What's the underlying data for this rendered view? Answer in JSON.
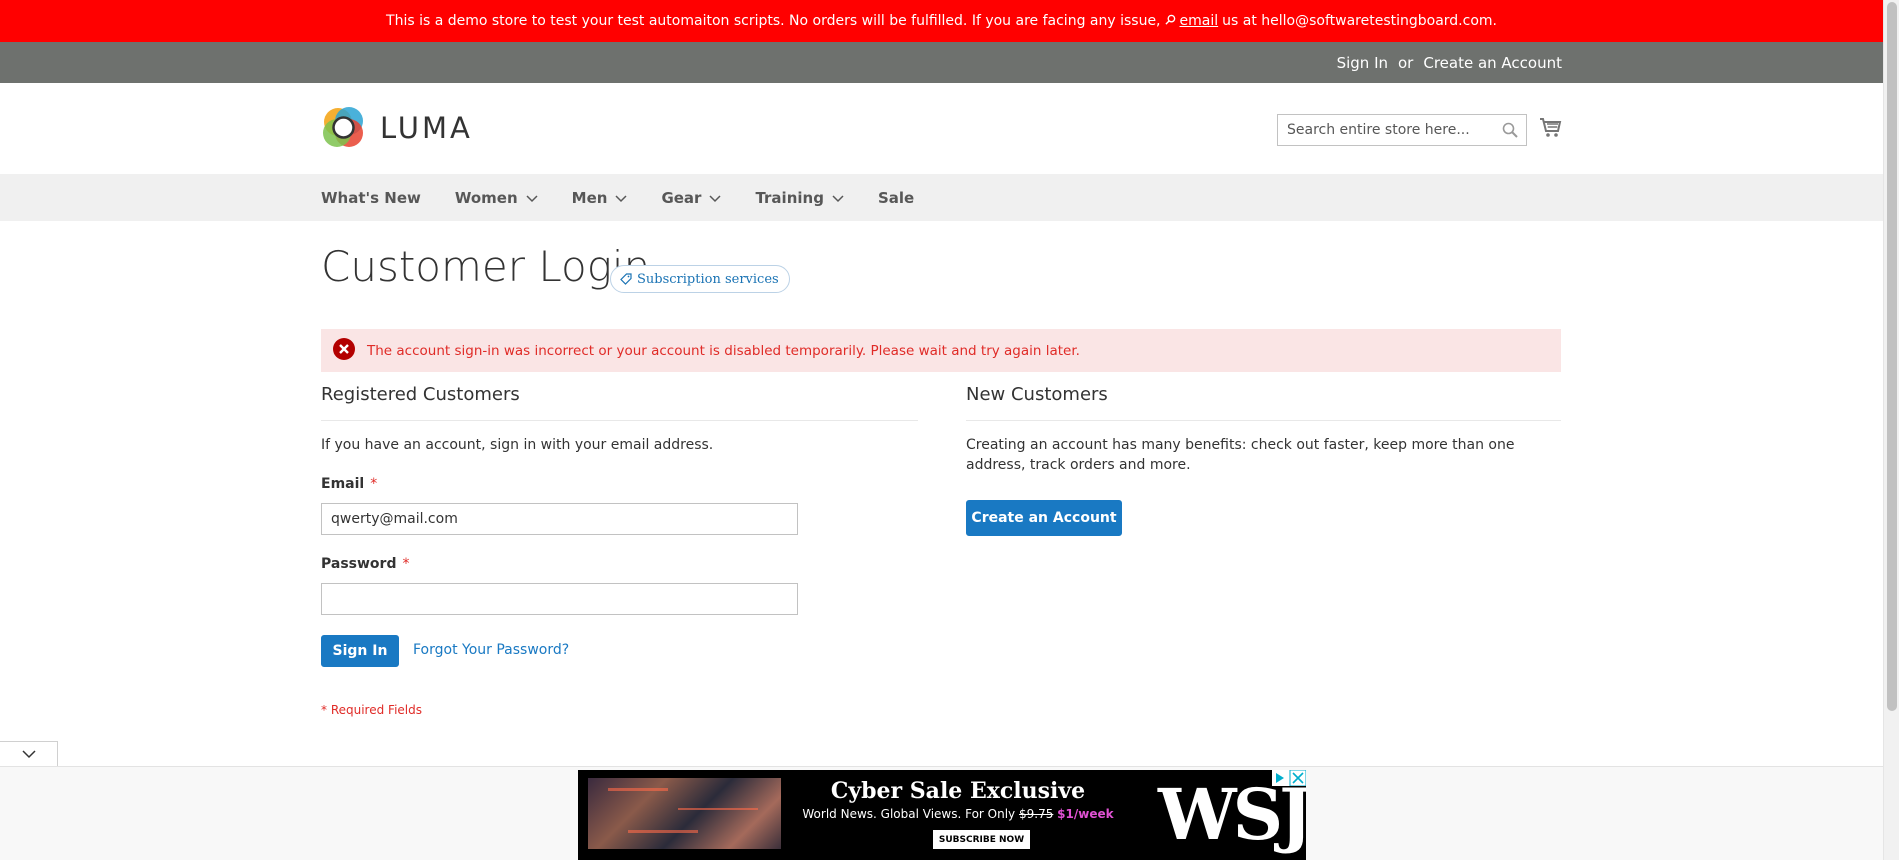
{
  "banner": {
    "text_before": "This is a demo store to test your test automaiton scripts. No orders will be fulfilled. If you are facing any issue,",
    "link": "email",
    "text_after": "us at hello@softwaretestingboard.com."
  },
  "panel": {
    "sign_in": "Sign In",
    "or": "or",
    "create_account": "Create an Account"
  },
  "header": {
    "logo_text": "LUMA",
    "search_placeholder": "Search entire store here..."
  },
  "nav": {
    "items": [
      {
        "label": "What's New",
        "has_menu": false
      },
      {
        "label": "Women",
        "has_menu": true
      },
      {
        "label": "Men",
        "has_menu": true
      },
      {
        "label": "Gear",
        "has_menu": true
      },
      {
        "label": "Training",
        "has_menu": true
      },
      {
        "label": "Sale",
        "has_menu": false
      }
    ]
  },
  "page": {
    "title": "Customer Login",
    "subscription_badge": "Subscription services",
    "error_message": "The account sign-in was incorrect or your account is disabled temporarily. Please wait and try again later."
  },
  "registered": {
    "title": "Registered Customers",
    "intro": "If you have an account, sign in with your email address.",
    "email_label": "Email",
    "email_value": "qwerty@mail.com",
    "password_label": "Password",
    "password_value": "",
    "required_marker": "*",
    "sign_in_button": "Sign In",
    "forgot_link": "Forgot Your Password?",
    "required_note": "* Required Fields"
  },
  "new_customers": {
    "title": "New Customers",
    "text": "Creating an account has many benefits: check out faster, keep more than one address, track orders and more.",
    "button": "Create an Account"
  },
  "ad": {
    "headline": "Cyber Sale Exclusive",
    "sub_before": "World News. Global Views. For Only",
    "old_price": "$9.75",
    "new_price": "$1/week",
    "cta": "SUBSCRIBE NOW",
    "brand": "WSJ"
  },
  "colors": {
    "banner": "#ff0000",
    "panel": "#6e716e",
    "accent": "#1979c3",
    "error_text": "#e02b27",
    "error_bg": "#fae5e5"
  }
}
